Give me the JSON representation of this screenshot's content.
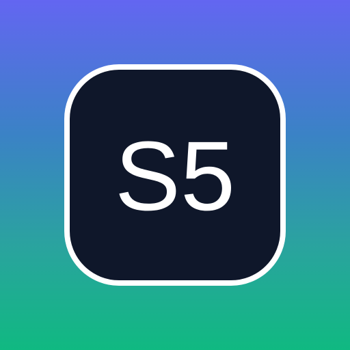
{
  "icon": {
    "label": "S5",
    "colors": {
      "background_top": "#6366f1",
      "background_bottom": "#10b981",
      "tile_fill": "#0f172a",
      "tile_border": "#ffffff",
      "label_color": "#ffffff"
    }
  }
}
